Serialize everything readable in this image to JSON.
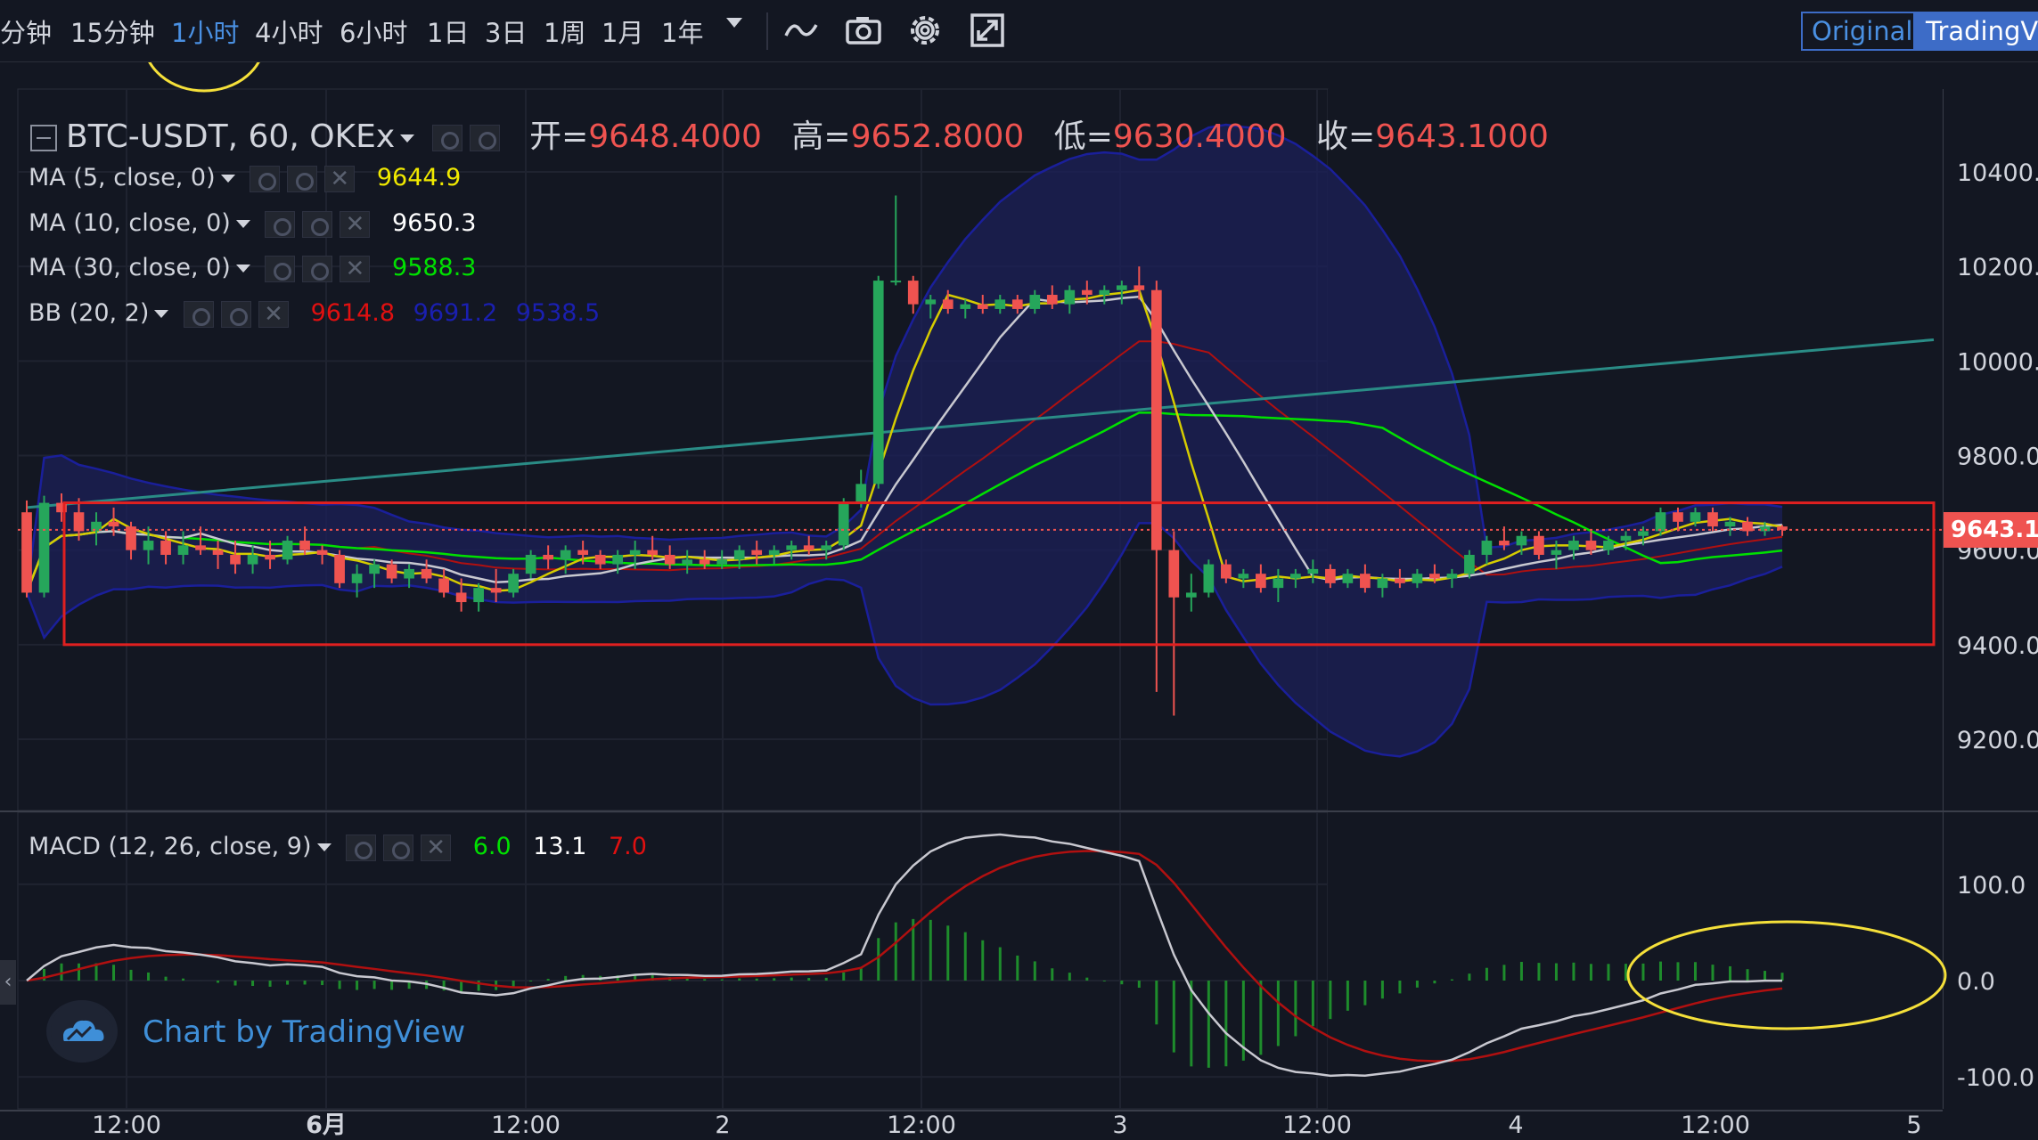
{
  "toolbar": {
    "timeframes": [
      "分钟",
      "15分钟",
      "1小时",
      "4小时",
      "6小时",
      "1日",
      "3日",
      "1周",
      "1月",
      "1年"
    ],
    "active_timeframe": "1小时",
    "view_original": "Original",
    "view_tradingview": "TradingVi"
  },
  "symbol": {
    "title": "BTC-USDT, 60, OKEx",
    "open_label": "开=",
    "open": "9648.4000",
    "high_label": "高=",
    "high": "9652.8000",
    "low_label": "低=",
    "low": "9630.4000",
    "close_label": "收=",
    "close": "9643.1000"
  },
  "indicators": {
    "ma5": {
      "label": "MA (5, close, 0)",
      "value": "9644.9",
      "color": "#f0e900"
    },
    "ma10": {
      "label": "MA (10, close, 0)",
      "value": "9650.3",
      "color": "#ffffff"
    },
    "ma30": {
      "label": "MA (30, close, 0)",
      "value": "9588.3",
      "color": "#00e000"
    },
    "bb": {
      "label": "BB (20, 2)",
      "mid": "9614.8",
      "upper": "9691.2",
      "lower": "9538.5"
    },
    "macd": {
      "label": "MACD (12, 26, close, 9)",
      "hist": "6.0",
      "macd": "13.1",
      "signal": "7.0"
    }
  },
  "last_price_tag": "9643.10",
  "watermark": "Chart by TradingView",
  "colors": {
    "background": "#131722",
    "up": "#26a65b",
    "down": "#ef5350",
    "bb_fill": "#1c2058",
    "bb_line": "#1a1f9a",
    "annotation_rect": "#e02020",
    "annotation_ellipse": "#f5e03a",
    "trendline": "#2a8c86"
  },
  "annotations": {
    "rectangle_price_range": [
      9400,
      9700
    ],
    "ellipse_targets": [
      "1小时",
      "MACD end"
    ]
  },
  "chart_data": {
    "type": "candlestick",
    "price_axis": {
      "ticks": [
        "10400.0",
        "10200.0",
        "10000.0",
        "9800.0",
        "9600.0",
        "9400.0",
        "9200.0"
      ],
      "range": [
        9100,
        10480
      ]
    },
    "macd_axis": {
      "ticks": [
        "100.0",
        "0.0",
        "-100.0"
      ],
      "range": [
        -110,
        160
      ]
    },
    "time_axis": {
      "ticks": [
        "12:00",
        "6月",
        "12:00",
        "2",
        "12:00",
        "3",
        "12:00",
        "4",
        "12:00",
        "5"
      ]
    },
    "candles": [
      [
        9680,
        9705,
        9500,
        9510
      ],
      [
        9510,
        9715,
        9500,
        9700
      ],
      [
        9700,
        9720,
        9660,
        9680
      ],
      [
        9680,
        9710,
        9620,
        9640
      ],
      [
        9640,
        9680,
        9610,
        9660
      ],
      [
        9660,
        9690,
        9630,
        9650
      ],
      [
        9650,
        9660,
        9580,
        9600
      ],
      [
        9600,
        9650,
        9570,
        9620
      ],
      [
        9620,
        9640,
        9570,
        9590
      ],
      [
        9590,
        9640,
        9570,
        9610
      ],
      [
        9610,
        9650,
        9590,
        9600
      ],
      [
        9600,
        9620,
        9560,
        9590
      ],
      [
        9590,
        9620,
        9550,
        9570
      ],
      [
        9570,
        9610,
        9550,
        9590
      ],
      [
        9590,
        9620,
        9560,
        9580
      ],
      [
        9580,
        9630,
        9570,
        9620
      ],
      [
        9620,
        9650,
        9590,
        9600
      ],
      [
        9600,
        9610,
        9570,
        9590
      ],
      [
        9590,
        9600,
        9520,
        9530
      ],
      [
        9530,
        9570,
        9500,
        9550
      ],
      [
        9550,
        9580,
        9520,
        9570
      ],
      [
        9570,
        9580,
        9530,
        9540
      ],
      [
        9540,
        9570,
        9520,
        9560
      ],
      [
        9560,
        9580,
        9530,
        9540
      ],
      [
        9540,
        9560,
        9500,
        9510
      ],
      [
        9510,
        9540,
        9470,
        9490
      ],
      [
        9490,
        9530,
        9470,
        9520
      ],
      [
        9520,
        9560,
        9490,
        9510
      ],
      [
        9510,
        9560,
        9500,
        9550
      ],
      [
        9550,
        9600,
        9540,
        9590
      ],
      [
        9590,
        9610,
        9560,
        9580
      ],
      [
        9580,
        9610,
        9550,
        9600
      ],
      [
        9600,
        9620,
        9570,
        9590
      ],
      [
        9590,
        9600,
        9560,
        9570
      ],
      [
        9570,
        9600,
        9550,
        9590
      ],
      [
        9590,
        9620,
        9560,
        9600
      ],
      [
        9600,
        9630,
        9580,
        9590
      ],
      [
        9590,
        9610,
        9560,
        9570
      ],
      [
        9570,
        9600,
        9550,
        9580
      ],
      [
        9580,
        9600,
        9560,
        9570
      ],
      [
        9570,
        9600,
        9560,
        9580
      ],
      [
        9580,
        9610,
        9560,
        9600
      ],
      [
        9600,
        9620,
        9570,
        9590
      ],
      [
        9590,
        9610,
        9570,
        9600
      ],
      [
        9600,
        9620,
        9580,
        9610
      ],
      [
        9610,
        9630,
        9590,
        9600
      ],
      [
        9600,
        9620,
        9580,
        9610
      ],
      [
        9610,
        9710,
        9600,
        9700
      ],
      [
        9700,
        9770,
        9690,
        9740
      ],
      [
        9740,
        10180,
        9730,
        10170
      ],
      [
        10170,
        10350,
        10160,
        10170
      ],
      [
        10170,
        10180,
        10100,
        10120
      ],
      [
        10120,
        10140,
        10090,
        10130
      ],
      [
        10130,
        10150,
        10100,
        10110
      ],
      [
        10110,
        10130,
        10090,
        10120
      ],
      [
        10120,
        10140,
        10100,
        10110
      ],
      [
        10110,
        10140,
        10100,
        10130
      ],
      [
        10130,
        10140,
        10100,
        10110
      ],
      [
        10110,
        10150,
        10100,
        10140
      ],
      [
        10140,
        10160,
        10110,
        10120
      ],
      [
        10120,
        10160,
        10100,
        10150
      ],
      [
        10150,
        10170,
        10120,
        10140
      ],
      [
        10140,
        10160,
        10120,
        10150
      ],
      [
        10150,
        10170,
        10120,
        10160
      ],
      [
        10160,
        10200,
        10130,
        10150
      ],
      [
        10150,
        10170,
        9300,
        9600
      ],
      [
        9600,
        9640,
        9250,
        9500
      ],
      [
        9500,
        9550,
        9470,
        9510
      ],
      [
        9510,
        9580,
        9500,
        9570
      ],
      [
        9570,
        9580,
        9530,
        9540
      ],
      [
        9540,
        9560,
        9520,
        9550
      ],
      [
        9550,
        9570,
        9510,
        9520
      ],
      [
        9520,
        9560,
        9490,
        9540
      ],
      [
        9540,
        9560,
        9520,
        9550
      ],
      [
        9550,
        9580,
        9530,
        9560
      ],
      [
        9560,
        9570,
        9520,
        9530
      ],
      [
        9530,
        9560,
        9520,
        9550
      ],
      [
        9550,
        9570,
        9510,
        9520
      ],
      [
        9520,
        9550,
        9500,
        9540
      ],
      [
        9540,
        9560,
        9520,
        9530
      ],
      [
        9530,
        9560,
        9520,
        9550
      ],
      [
        9550,
        9570,
        9530,
        9540
      ],
      [
        9540,
        9560,
        9520,
        9550
      ],
      [
        9550,
        9600,
        9540,
        9590
      ],
      [
        9590,
        9630,
        9570,
        9620
      ],
      [
        9620,
        9650,
        9600,
        9610
      ],
      [
        9610,
        9640,
        9590,
        9630
      ],
      [
        9630,
        9640,
        9580,
        9590
      ],
      [
        9590,
        9620,
        9560,
        9600
      ],
      [
        9600,
        9630,
        9580,
        9620
      ],
      [
        9620,
        9640,
        9590,
        9600
      ],
      [
        9600,
        9630,
        9590,
        9620
      ],
      [
        9620,
        9640,
        9600,
        9630
      ],
      [
        9630,
        9650,
        9610,
        9640
      ],
      [
        9640,
        9690,
        9630,
        9680
      ],
      [
        9680,
        9690,
        9640,
        9660
      ],
      [
        9660,
        9690,
        9650,
        9680
      ],
      [
        9680,
        9690,
        9640,
        9650
      ],
      [
        9650,
        9670,
        9630,
        9660
      ],
      [
        9660,
        9670,
        9630,
        9640
      ],
      [
        9640,
        9660,
        9630,
        9650
      ],
      [
        9650,
        9653,
        9630,
        9643
      ]
    ]
  }
}
